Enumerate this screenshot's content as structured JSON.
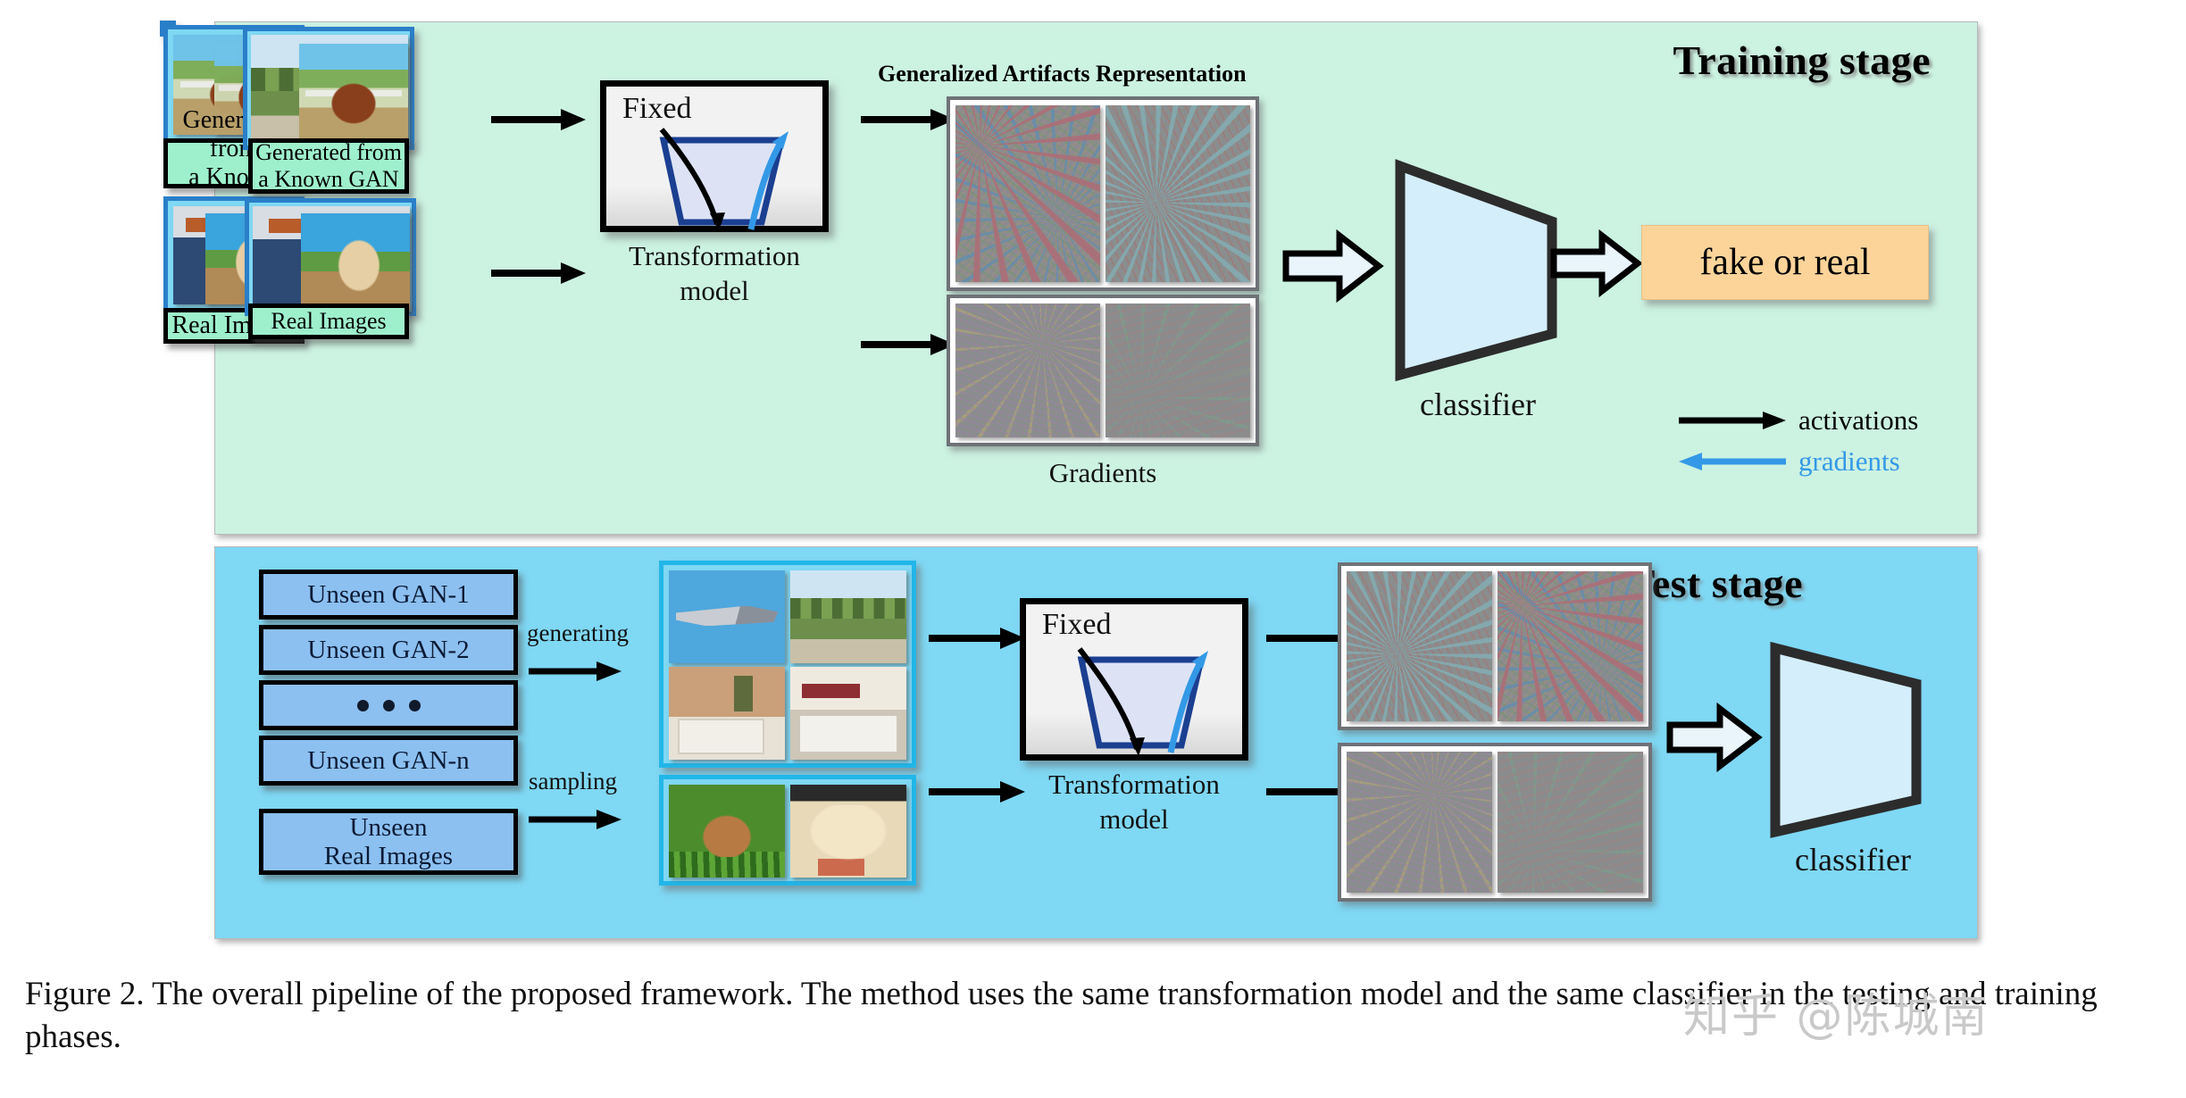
{
  "figure": {
    "caption": "Figure 2. The overall pipeline of the proposed framework. The method uses the same transformation model and the same classifier in the testing and training phases.",
    "watermark": "知乎 @陈城南"
  },
  "training_stage": {
    "title": "Training stage",
    "inputs": [
      {
        "caption": "Generated from\na Known GAN",
        "caption_line1": "Generated from",
        "caption_line2": "a Known GAN"
      },
      {
        "caption": "Real Images"
      }
    ],
    "transformation_model": {
      "inner_label": "Fixed",
      "caption_line1": "Transformation",
      "caption_line2": "model"
    },
    "representation_header": "Generalized Artifacts Representation",
    "gradients_label": "Gradients",
    "classifier_label": "classifier",
    "output_label": "fake or real",
    "legend": [
      {
        "label": "activations",
        "color": "#000000",
        "direction": "right"
      },
      {
        "label": "gradients",
        "color": "#3399e6",
        "direction": "left"
      }
    ]
  },
  "test_stage": {
    "title": "Test stage",
    "source_boxes": [
      {
        "label": "Unseen GAN-1"
      },
      {
        "label": "Unseen GAN-2"
      },
      {
        "label": "•••"
      },
      {
        "label": "Unseen GAN-n"
      },
      {
        "label": "Unseen\nReal Images",
        "line1": "Unseen",
        "line2": "Real Images"
      }
    ],
    "arrow_labels": {
      "generating": "generating",
      "sampling": "sampling"
    },
    "transformation_model": {
      "inner_label": "Fixed",
      "caption_line1": "Transformation",
      "caption_line2": "model"
    },
    "classifier_label": "classifier"
  },
  "colors": {
    "training_panel_bg": "#ccf2e2",
    "test_panel_bg": "#7fd8f4",
    "gan_box_bg": "#8cc0f0",
    "caption_box_bg": "#9ef0cc",
    "output_box_bg": "#fcd49a",
    "classifier_fill": "#d5eefb",
    "gradient_arrow": "#3399e6",
    "activation_arrow": "#000000",
    "photo_frame_border": "#2a7fc9",
    "photo_frame_border_cyan": "#22b6e8"
  },
  "icons": {
    "arrow_right": "arrow-right-icon",
    "arrow_left": "arrow-left-icon",
    "block_arrow": "block-arrow-right-icon",
    "funnel": "funnel-icon"
  }
}
